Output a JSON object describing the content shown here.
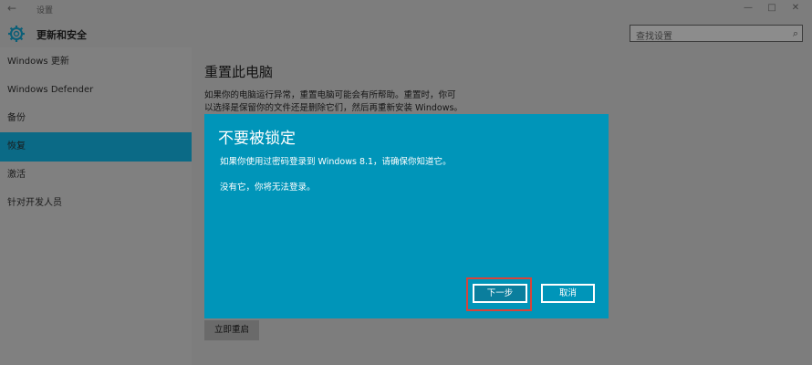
{
  "window": {
    "title": "设置",
    "header_title": "更新和安全",
    "controls": {
      "minimize": "—",
      "maximize": "□",
      "close": "✕"
    }
  },
  "search": {
    "placeholder": "查找设置"
  },
  "sidebar": {
    "items": [
      {
        "label": "Windows 更新"
      },
      {
        "label": "Windows Defender"
      },
      {
        "label": "备份"
      },
      {
        "label": "恢复",
        "active": true
      },
      {
        "label": "激活"
      },
      {
        "label": "针对开发人员"
      }
    ]
  },
  "main": {
    "title": "重置此电脑",
    "desc_line1": "如果你的电脑运行异常，重置电脑可能会有所帮助。重置时，你可",
    "desc_line2": "以选择是保留你的文件还是删除它们，然后再重新安装 Windows。",
    "restart_label": "立即重启"
  },
  "dialog": {
    "title": "不要被锁定",
    "line1": "如果你使用过密码登录到 Windows 8.1，请确保你知道它。",
    "line2": "没有它，你将无法登录。",
    "next_label": "下一步",
    "cancel_label": "取消"
  },
  "colors": {
    "dialog_bg": "#0095b9",
    "highlight": "#d6433a",
    "active_nav": "#0b6a86"
  }
}
